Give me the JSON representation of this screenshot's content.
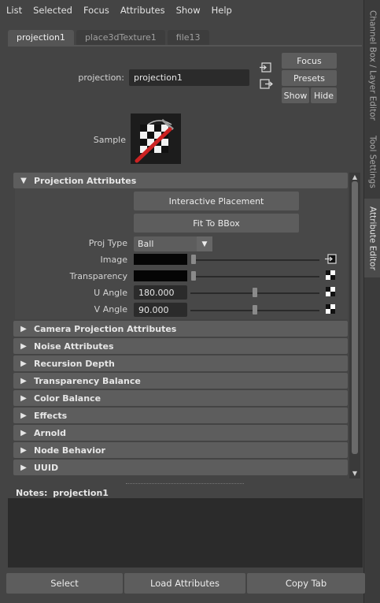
{
  "menu": [
    "List",
    "Selected",
    "Focus",
    "Attributes",
    "Show",
    "Help"
  ],
  "dock_tabs": [
    "Channel Box / Layer Editor",
    "Tool Settings",
    "Attribute Editor"
  ],
  "tabs": [
    "projection1",
    "place3dTexture1",
    "file13"
  ],
  "node": {
    "label": "projection:",
    "value": "projection1"
  },
  "side_buttons": {
    "focus": "Focus",
    "presets": "Presets",
    "show": "Show",
    "hide": "Hide"
  },
  "sample_label": "Sample",
  "section": {
    "title": "Projection Attributes",
    "interactive_placement": "Interactive Placement",
    "fit_to_bbox": "Fit To BBox",
    "proj_type_label": "Proj Type",
    "proj_type_value": "Ball",
    "image_label": "Image",
    "transparency_label": "Transparency",
    "u_angle_label": "U Angle",
    "u_angle_value": "180.000",
    "u_angle_slider": 0.5,
    "v_angle_label": "V Angle",
    "v_angle_value": "90.000",
    "v_angle_slider": 0.5
  },
  "collapsed_sections": [
    "Camera Projection Attributes",
    "Noise Attributes",
    "Recursion Depth",
    "Transparency Balance",
    "Color Balance",
    "Effects",
    "Arnold",
    "Node Behavior",
    "UUID"
  ],
  "notes": {
    "label": "Notes:",
    "value": "projection1"
  },
  "bottom_buttons": {
    "select": "Select",
    "load": "Load Attributes",
    "copy": "Copy Tab"
  },
  "colors": {
    "panel": "#444444",
    "frame": "#5d5d5d",
    "field": "#2b2b2b",
    "accent_red": "#cc2222"
  }
}
